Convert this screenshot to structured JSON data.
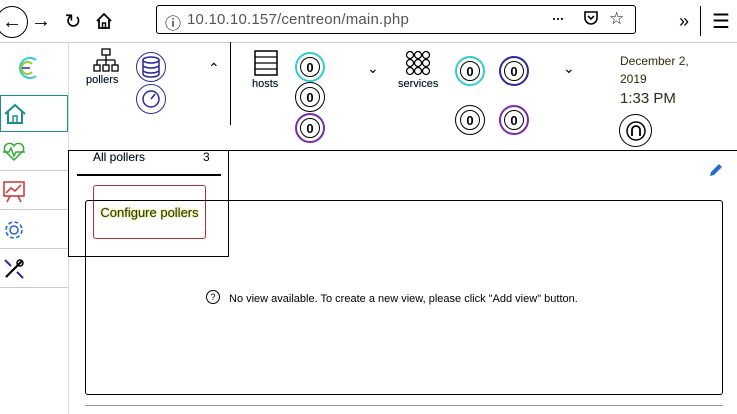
{
  "browser": {
    "url": "10.10.10.157/centreon/main.php"
  },
  "header": {
    "pollers_label": "pollers",
    "hosts_label": "hosts",
    "services_label": "services",
    "hosts_counts": [
      "0",
      "0",
      "0"
    ],
    "services_counts": [
      "0",
      "0",
      "0",
      "0"
    ],
    "date": "December 2, 2019",
    "time": "1:33 PM"
  },
  "pollers_dropdown": {
    "all_pollers_label": "All pollers",
    "all_pollers_count": "3",
    "configure_label": "Configure pollers"
  },
  "main": {
    "empty_message": "No view available. To create a new view, please click \"Add view\" button."
  },
  "colors": {
    "cyan": "#3cc",
    "navy": "#2a2a9a",
    "purple": "#7a2aa6",
    "teal": "#1a8f8f"
  }
}
